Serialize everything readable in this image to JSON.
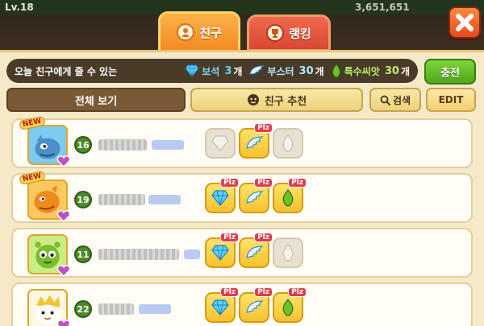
{
  "topbar": {
    "level": "Lv.18",
    "coins": "3,651,651"
  },
  "tabs": [
    {
      "label": "친구"
    },
    {
      "label": "랭킹"
    }
  ],
  "info_bar": {
    "text": "오늘 친구에게 줄 수 있는",
    "gifts": [
      {
        "label": "보석",
        "count": "3",
        "unit": "개"
      },
      {
        "label": "부스터",
        "count": "30",
        "unit": "개"
      },
      {
        "label": "특수씨앗",
        "count": "30",
        "unit": "개"
      }
    ]
  },
  "charge_label": "충전",
  "filters": {
    "all_label": "전체 보기",
    "recommend_label": "친구 추천",
    "search_label": "검색",
    "edit_label": "EDIT"
  },
  "friends": [
    {
      "level": "16",
      "new": "NEW",
      "gifts": {
        "diamond": false,
        "booster": true,
        "seed": false
      }
    },
    {
      "level": "19",
      "new": "NEW",
      "gifts": {
        "diamond": true,
        "booster": true,
        "seed": true
      }
    },
    {
      "level": "11",
      "new": "",
      "gifts": {
        "diamond": true,
        "booster": true,
        "seed": false
      }
    },
    {
      "level": "22",
      "new": "",
      "gifts": {
        "diamond": true,
        "booster": true,
        "seed": true
      }
    }
  ],
  "plz_label": "Plz"
}
